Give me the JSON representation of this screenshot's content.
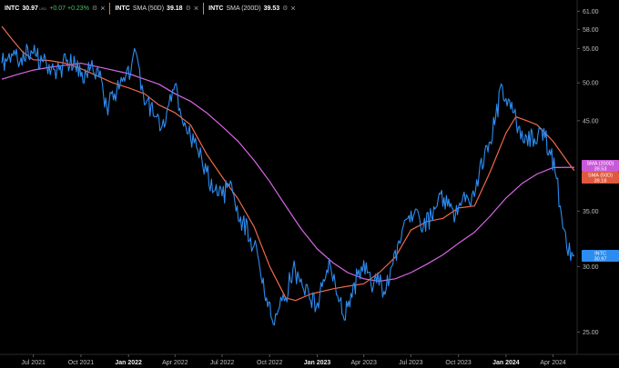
{
  "legend": {
    "price": {
      "symbol": "INTC",
      "value": "30.97",
      "sub": "USD",
      "change": "+0.07 +0.23%",
      "color": "#2d8cf0"
    },
    "sma50": {
      "symbol": "INTC",
      "name": "SMA (50D)",
      "value": "39.18",
      "color": "#f0694a"
    },
    "sma200": {
      "symbol": "INTC",
      "name": "SMA (200D)",
      "value": "39.53",
      "color": "#d966e6"
    }
  },
  "tags": [
    {
      "label": "SMA (200D)",
      "value": "39.53",
      "color": "#c85ad8"
    },
    {
      "label": "SMA (50D)",
      "value": "39.18",
      "color": "#e0583e"
    },
    {
      "label": "INTC",
      "value": "30.97",
      "color": "#2d8cf0"
    }
  ],
  "chart_data": {
    "type": "line",
    "y_scale": "log",
    "ylim": [
      23.5,
      62
    ],
    "y_ticks": [
      "61.00",
      "58.00",
      "55.00",
      "50.00",
      "45.00",
      "35.00",
      "30.00",
      "25.00"
    ],
    "x_ticks": [
      {
        "label": "Jul 2021",
        "bold": false
      },
      {
        "label": "Oct 2021",
        "bold": false
      },
      {
        "label": "Jan 2022",
        "bold": true
      },
      {
        "label": "Apr 2022",
        "bold": false
      },
      {
        "label": "Jul 2022",
        "bold": false
      },
      {
        "label": "Oct 2022",
        "bold": false
      },
      {
        "label": "Jan 2023",
        "bold": true
      },
      {
        "label": "Apr 2023",
        "bold": false
      },
      {
        "label": "Jul 2023",
        "bold": false
      },
      {
        "label": "Oct 2023",
        "bold": false
      },
      {
        "label": "Jan 2024",
        "bold": true
      },
      {
        "label": "Apr 2024",
        "bold": false
      }
    ],
    "series": [
      {
        "name": "INTC",
        "color": "#2d8cf0",
        "points": [
          [
            "2021-05-01",
            52.8
          ],
          [
            "2021-05-20",
            54.2
          ],
          [
            "2021-06-05",
            53.0
          ],
          [
            "2021-06-20",
            55.2
          ],
          [
            "2021-07-05",
            54.0
          ],
          [
            "2021-07-20",
            53.0
          ],
          [
            "2021-08-05",
            52.0
          ],
          [
            "2021-08-20",
            51.8
          ],
          [
            "2021-09-05",
            53.3
          ],
          [
            "2021-09-20",
            52.5
          ],
          [
            "2021-10-05",
            50.0
          ],
          [
            "2021-10-20",
            52.3
          ],
          [
            "2021-11-05",
            50.8
          ],
          [
            "2021-11-20",
            46.8
          ],
          [
            "2021-12-05",
            48.5
          ],
          [
            "2021-12-20",
            50.2
          ],
          [
            "2022-01-05",
            51.2
          ],
          [
            "2022-01-15",
            54.5
          ],
          [
            "2022-01-25",
            49.0
          ],
          [
            "2022-02-05",
            47.5
          ],
          [
            "2022-02-20",
            45.5
          ],
          [
            "2022-03-05",
            44.0
          ],
          [
            "2022-03-20",
            47.0
          ],
          [
            "2022-04-01",
            49.8
          ],
          [
            "2022-04-15",
            45.0
          ],
          [
            "2022-05-01",
            43.0
          ],
          [
            "2022-05-15",
            41.5
          ],
          [
            "2022-06-01",
            39.0
          ],
          [
            "2022-06-15",
            37.0
          ],
          [
            "2022-07-01",
            36.5
          ],
          [
            "2022-07-15",
            37.5
          ],
          [
            "2022-07-28",
            35.0
          ],
          [
            "2022-08-10",
            34.0
          ],
          [
            "2022-08-25",
            32.5
          ],
          [
            "2022-09-10",
            30.5
          ],
          [
            "2022-09-25",
            27.5
          ],
          [
            "2022-10-10",
            25.5
          ],
          [
            "2022-10-20",
            26.8
          ],
          [
            "2022-11-01",
            27.5
          ],
          [
            "2022-11-15",
            29.8
          ],
          [
            "2022-12-01",
            29.0
          ],
          [
            "2022-12-15",
            28.0
          ],
          [
            "2022-12-30",
            26.8
          ],
          [
            "2023-01-15",
            28.8
          ],
          [
            "2023-01-26",
            30.2
          ],
          [
            "2023-02-05",
            28.5
          ],
          [
            "2023-02-20",
            26.2
          ],
          [
            "2023-03-05",
            26.8
          ],
          [
            "2023-03-20",
            29.3
          ],
          [
            "2023-04-01",
            30.5
          ],
          [
            "2023-04-15",
            28.5
          ],
          [
            "2023-04-28",
            29.5
          ],
          [
            "2023-05-10",
            28.0
          ],
          [
            "2023-05-25",
            30.0
          ],
          [
            "2023-06-10",
            32.0
          ],
          [
            "2023-06-25",
            34.3
          ],
          [
            "2023-07-10",
            35.2
          ],
          [
            "2023-07-25",
            33.5
          ],
          [
            "2023-08-10",
            34.5
          ],
          [
            "2023-08-25",
            36.8
          ],
          [
            "2023-09-10",
            35.5
          ],
          [
            "2023-09-25",
            34.5
          ],
          [
            "2023-10-10",
            36.5
          ],
          [
            "2023-10-25",
            35.5
          ],
          [
            "2023-11-10",
            38.8
          ],
          [
            "2023-11-25",
            42.0
          ],
          [
            "2023-12-10",
            44.5
          ],
          [
            "2023-12-25",
            49.5
          ],
          [
            "2024-01-10",
            46.5
          ],
          [
            "2024-01-25",
            44.2
          ],
          [
            "2024-02-10",
            43.0
          ],
          [
            "2024-02-25",
            42.8
          ],
          [
            "2024-03-10",
            44.0
          ],
          [
            "2024-03-25",
            41.5
          ],
          [
            "2024-04-05",
            39.0
          ],
          [
            "2024-04-15",
            35.5
          ],
          [
            "2024-04-25",
            33.0
          ],
          [
            "2024-05-05",
            30.5
          ],
          [
            "2024-05-12",
            30.97
          ]
        ]
      },
      {
        "name": "SMA (50D)",
        "color": "#f0694a",
        "points": [
          [
            "2021-05-01",
            58.5
          ],
          [
            "2021-05-20",
            56.5
          ],
          [
            "2021-06-10",
            54.5
          ],
          [
            "2021-07-01",
            53.3
          ],
          [
            "2021-08-01",
            53.2
          ],
          [
            "2021-09-01",
            52.8
          ],
          [
            "2021-10-01",
            52.0
          ],
          [
            "2021-11-01",
            51.0
          ],
          [
            "2021-12-01",
            50.0
          ],
          [
            "2022-01-01",
            49.3
          ],
          [
            "2022-02-01",
            48.5
          ],
          [
            "2022-03-01",
            47.0
          ],
          [
            "2022-04-01",
            46.0
          ],
          [
            "2022-05-01",
            44.5
          ],
          [
            "2022-06-01",
            41.0
          ],
          [
            "2022-07-01",
            38.5
          ],
          [
            "2022-08-01",
            36.2
          ],
          [
            "2022-09-01",
            33.5
          ],
          [
            "2022-10-01",
            30.0
          ],
          [
            "2022-11-01",
            27.5
          ],
          [
            "2022-11-20",
            27.3
          ],
          [
            "2022-12-20",
            27.8
          ],
          [
            "2023-02-01",
            28.2
          ],
          [
            "2023-03-01",
            28.4
          ],
          [
            "2023-04-01",
            28.6
          ],
          [
            "2023-05-01",
            29.5
          ],
          [
            "2023-06-01",
            30.8
          ],
          [
            "2023-07-01",
            33.2
          ],
          [
            "2023-08-01",
            34.0
          ],
          [
            "2023-09-01",
            34.3
          ],
          [
            "2023-10-01",
            35.3
          ],
          [
            "2023-11-01",
            35.5
          ],
          [
            "2023-12-01",
            39.0
          ],
          [
            "2024-01-01",
            43.5
          ],
          [
            "2024-01-20",
            45.5
          ],
          [
            "2024-02-10",
            45.0
          ],
          [
            "2024-03-01",
            44.5
          ],
          [
            "2024-04-01",
            42.5
          ],
          [
            "2024-05-01",
            40.0
          ],
          [
            "2024-05-12",
            39.18
          ]
        ]
      },
      {
        "name": "SMA (200D)",
        "color": "#d966e6",
        "points": [
          [
            "2021-05-01",
            50.5
          ],
          [
            "2021-06-01",
            51.2
          ],
          [
            "2021-07-01",
            51.8
          ],
          [
            "2021-08-01",
            52.2
          ],
          [
            "2021-09-01",
            52.5
          ],
          [
            "2021-10-01",
            52.8
          ],
          [
            "2021-11-01",
            52.3
          ],
          [
            "2021-12-01",
            51.8
          ],
          [
            "2022-01-01",
            51.3
          ],
          [
            "2022-02-01",
            50.5
          ],
          [
            "2022-03-01",
            49.8
          ],
          [
            "2022-04-01",
            48.5
          ],
          [
            "2022-05-01",
            47.5
          ],
          [
            "2022-06-01",
            46.0
          ],
          [
            "2022-07-01",
            44.3
          ],
          [
            "2022-08-01",
            42.5
          ],
          [
            "2022-09-01",
            40.3
          ],
          [
            "2022-10-01",
            38.0
          ],
          [
            "2022-11-01",
            35.5
          ],
          [
            "2022-12-01",
            33.3
          ],
          [
            "2023-01-01",
            31.5
          ],
          [
            "2023-02-01",
            30.3
          ],
          [
            "2023-03-01",
            29.5
          ],
          [
            "2023-04-01",
            29.0
          ],
          [
            "2023-05-01",
            28.8
          ],
          [
            "2023-06-01",
            29.0
          ],
          [
            "2023-07-01",
            29.5
          ],
          [
            "2023-08-01",
            30.2
          ],
          [
            "2023-09-01",
            31.0
          ],
          [
            "2023-10-01",
            32.0
          ],
          [
            "2023-11-01",
            33.0
          ],
          [
            "2023-12-01",
            34.5
          ],
          [
            "2024-01-01",
            36.3
          ],
          [
            "2024-02-01",
            37.8
          ],
          [
            "2024-03-01",
            38.8
          ],
          [
            "2024-04-01",
            39.5
          ],
          [
            "2024-05-12",
            39.53
          ]
        ]
      }
    ]
  }
}
